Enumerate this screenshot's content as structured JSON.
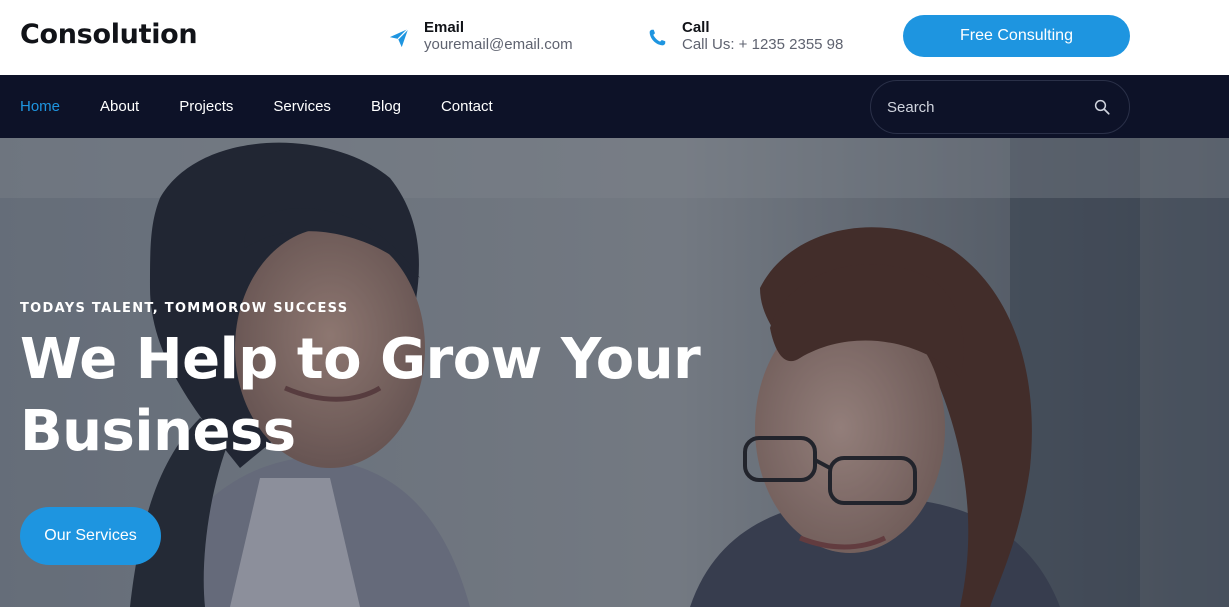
{
  "header": {
    "logo": "Consolution",
    "email": {
      "label": "Email",
      "value": "youremail@email.com",
      "icon": "paper-plane-icon"
    },
    "call": {
      "label": "Call",
      "value": "Call Us: + 1235 2355 98",
      "icon": "phone-icon"
    },
    "cta_label": "Free Consulting"
  },
  "nav": {
    "items": [
      {
        "label": "Home",
        "active": true
      },
      {
        "label": "About"
      },
      {
        "label": "Projects"
      },
      {
        "label": "Services"
      },
      {
        "label": "Blog"
      },
      {
        "label": "Contact"
      }
    ],
    "search": {
      "placeholder": "Search",
      "value": "",
      "icon": "search-icon"
    }
  },
  "hero": {
    "eyebrow": "TODAYS TALENT, TOMMOROW SUCCESS",
    "title_line1": "We Help to Grow Your",
    "title_line2": "Business",
    "cta_label": "Our Services"
  },
  "colors": {
    "accent": "#1e95e0",
    "nav_background": "#0d1228",
    "text_dark": "#111318",
    "text_muted": "#5f6370"
  }
}
